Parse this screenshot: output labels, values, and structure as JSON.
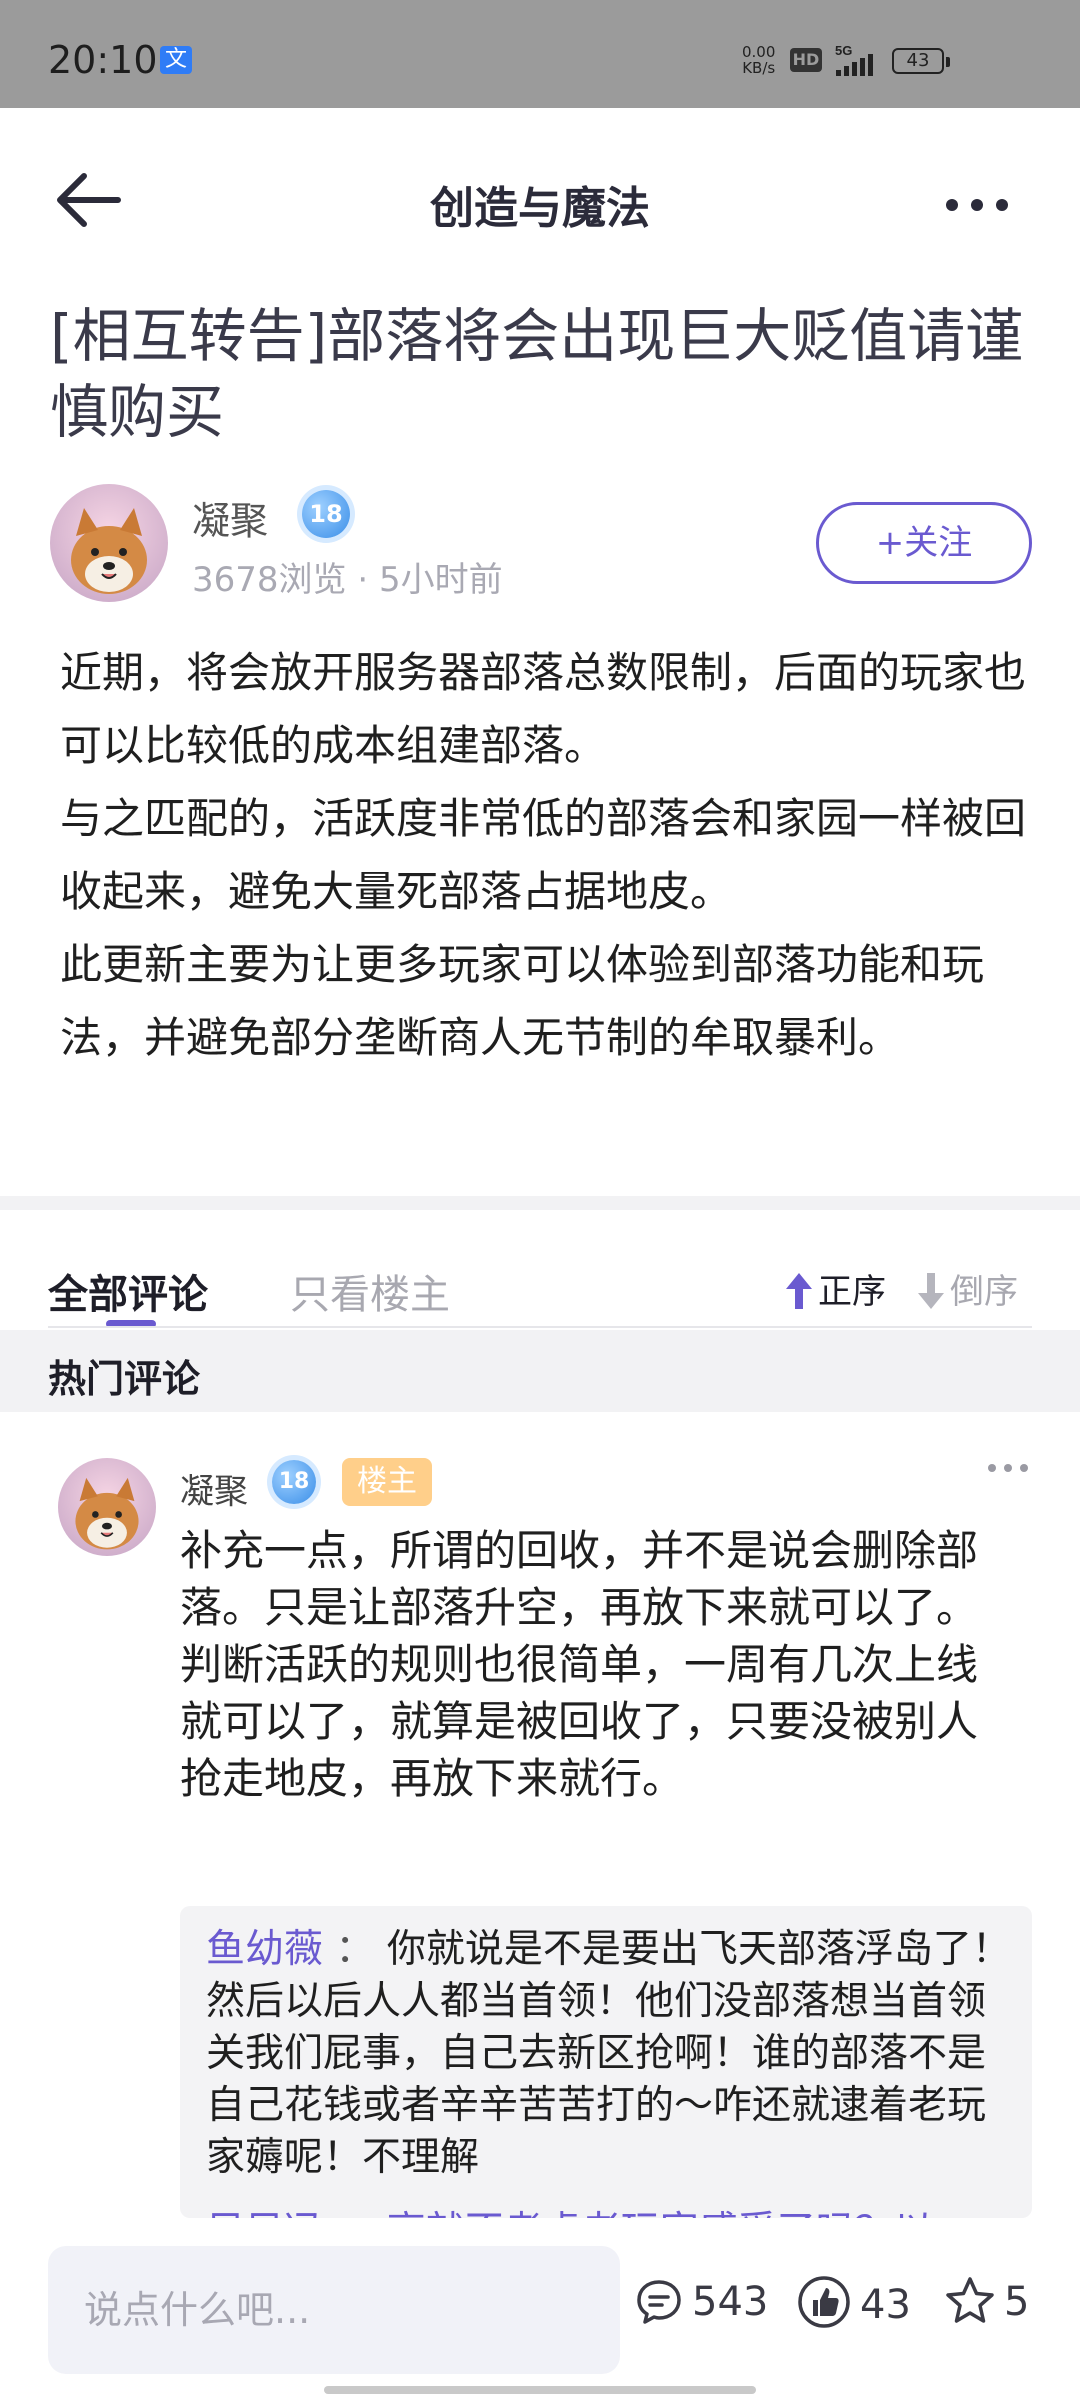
{
  "status_bar": {
    "time": "20:10",
    "app_icon": "文",
    "speed_value": "0.00",
    "speed_unit": "KB/s",
    "hd": "HD",
    "network": "5G",
    "battery": "43"
  },
  "header": {
    "title": "创造与魔法"
  },
  "post": {
    "title": "[相互转告]部落将会出现巨大贬值请谨慎购买",
    "author": {
      "name": "凝聚",
      "level": "18",
      "views": "3678浏览",
      "time": "5小时前"
    },
    "follow_label": "+关注",
    "paragraphs": [
      "近期，将会放开服务器部落总数限制，后面的玩家也可以比较低的成本组建部落。",
      "与之匹配的，活跃度非常低的部落会和家园一样被回收起来，避免大量死部落占据地皮。",
      "此更新主要为让更多玩家可以体验到部落功能和玩法，并避免部分垄断商人无节制的牟取暴利。"
    ]
  },
  "tabs": {
    "all": "全部评论",
    "op_only": "只看楼主",
    "sort_asc": "正序",
    "sort_desc": "倒序"
  },
  "hot_comments": {
    "label": "热门评论"
  },
  "comment": {
    "name": "凝聚",
    "level": "18",
    "badge": "楼主",
    "text": "补充一点，所谓的回收，并不是说会删除部落。只是让部落升空，再放下来就可以了。判断活跃的规则也很简单，一周有几次上线就可以了，就算是被回收了，只要没被别人抢走地皮，再放下来就行。",
    "reply": {
      "author": "鱼幼薇",
      "separator": " ： ",
      "text": "你就说是不是要出飞天部落浮岛了！然后以后人人都当首领！他们没部落想当首领关我们屁事，自己去新区抢啊！谁的部落不是自己花钱或者辛辛苦苦打的～咋还就逮着老玩家薅呢！不理解"
    },
    "reply_next_partial": "目目冯 ： 高就不考虑老玩家感受了吗？以"
  },
  "bottom_bar": {
    "input_placeholder": "说点什么吧...",
    "comments_count": "543",
    "likes_count": "43",
    "favorites_count": "5"
  },
  "colors": {
    "accent": "#6a5ad0",
    "status_bar_bg": "#9b9b9b",
    "op_badge": "#ffcf8a"
  }
}
